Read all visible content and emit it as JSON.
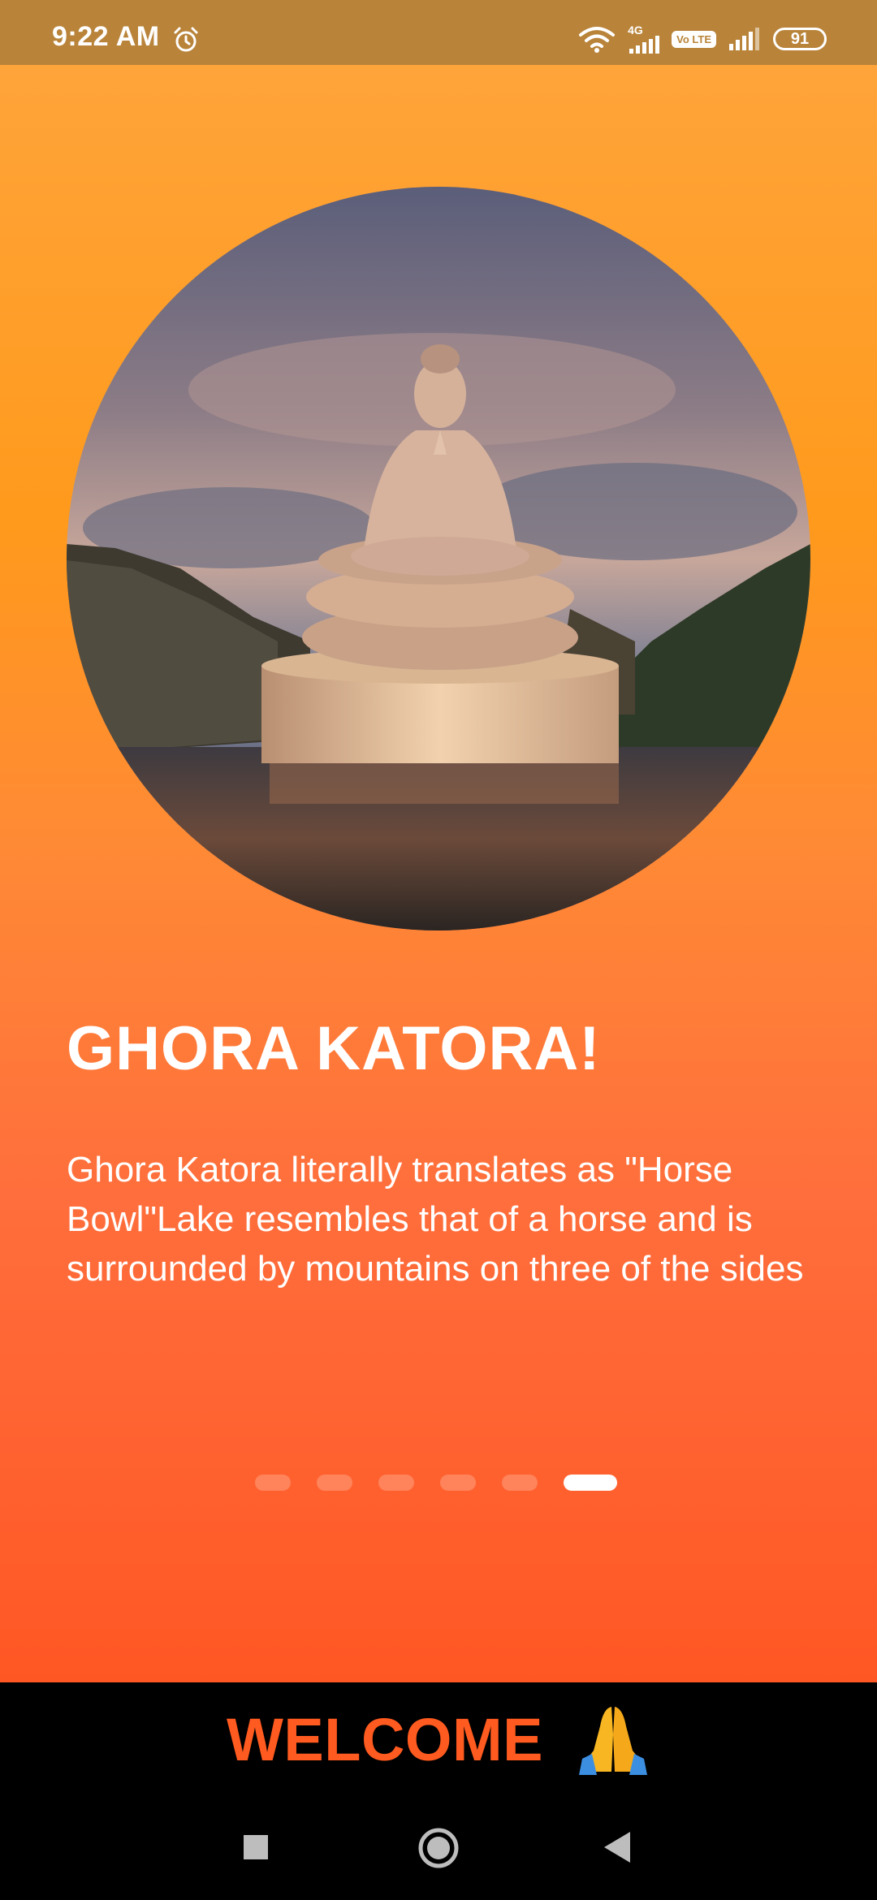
{
  "status_bar": {
    "time": "9:22 AM",
    "network_tag": "4G",
    "volte_label": "Vo LTE",
    "battery": "91",
    "icons": [
      "alarm-icon",
      "wifi-icon",
      "signal-icon",
      "signal-icon-2",
      "battery-icon"
    ]
  },
  "slide": {
    "title": "GHORA KATORA!",
    "description": "Ghora Katora literally translates as \"Horse Bowl\"Lake resembles that of a horse and is surrounded by mountains on three of the sides",
    "image_icon": "buddha-statue-lake-image"
  },
  "pager": {
    "count": 6,
    "active_index": 5
  },
  "footer": {
    "welcome_label": "WELCOME",
    "emoji": "🙏"
  },
  "nav": {
    "recents": "square-icon",
    "home": "circle-icon",
    "back": "back-triangle-icon"
  },
  "colors": {
    "status_bar": "#B9843A",
    "gradient_top": "#FFA43A",
    "gradient_bottom": "#FF5724",
    "welcome_text": "#FF5A1F"
  }
}
